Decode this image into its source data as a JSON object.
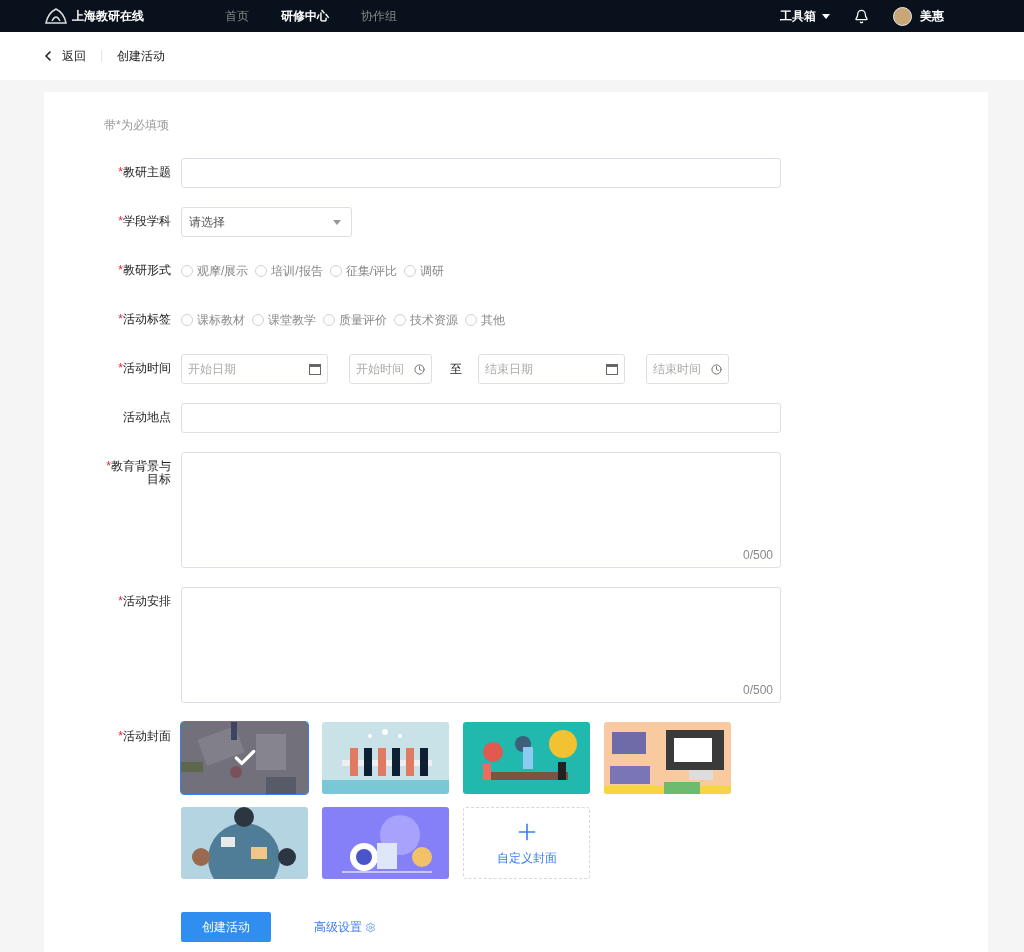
{
  "topbar": {
    "logo": "上海教研在线",
    "nav": [
      {
        "label": "首页",
        "selected": false
      },
      {
        "label": "研修中心",
        "selected": true
      },
      {
        "label": "协作组",
        "selected": false
      }
    ],
    "toolbox": "工具箱",
    "user": "美惠"
  },
  "breadcrumb": {
    "back": "返回",
    "current": "创建活动"
  },
  "form": {
    "note": "带*为必填项",
    "fields": [
      {
        "kind": "text",
        "mark": "*",
        "label": "教研主题"
      },
      {
        "kind": "select",
        "mark": "*",
        "label": "学段学科",
        "placeholder": "请选择"
      },
      {
        "kind": "radio",
        "mark": "*",
        "label": "教研形式",
        "options": [
          {
            "label": "观摩/展示",
            "selected": false
          },
          {
            "label": "培训/报告",
            "selected": false
          },
          {
            "label": "征集/评比",
            "selected": false
          },
          {
            "label": "调研",
            "selected": false
          }
        ]
      },
      {
        "kind": "radio",
        "mark": "*",
        "label": "活动标签",
        "options": [
          {
            "label": "课标教材",
            "selected": false
          },
          {
            "label": "课堂教学",
            "selected": false
          },
          {
            "label": "质量评价",
            "selected": false
          },
          {
            "label": "技术资源",
            "selected": false
          },
          {
            "label": "其他",
            "selected": false
          }
        ]
      },
      {
        "kind": "datetime",
        "mark": "*",
        "label": "活动时间",
        "start_date": "开始日期",
        "start_time": "开始时间",
        "separator": "至",
        "end_date": "结束日期",
        "end_time": "结束时间"
      },
      {
        "kind": "text",
        "label": "活动地点"
      },
      {
        "kind": "textarea",
        "mark": "*",
        "label": "教育背景与目标",
        "counter": "0/500"
      },
      {
        "kind": "textarea",
        "mark": "*",
        "label": "活动安排",
        "counter": "0/500"
      },
      {
        "kind": "covers",
        "mark": "*",
        "label": "活动封面",
        "covers": [
          {
            "kind": "picture",
            "selected": true
          },
          {
            "kind": "picture",
            "selected": false
          },
          {
            "kind": "picture",
            "selected": false
          },
          {
            "kind": "picture",
            "selected": false
          },
          {
            "kind": "picture",
            "selected": false
          },
          {
            "kind": "picture",
            "selected": false
          }
        ],
        "custom": "自定义封面"
      }
    ],
    "submit": "创建活动",
    "advanced": "高级设置"
  }
}
